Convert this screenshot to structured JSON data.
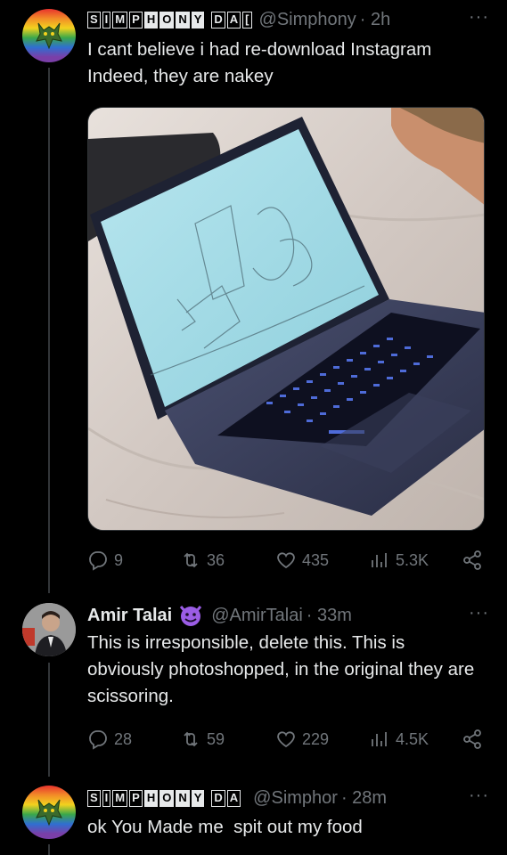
{
  "tweets": [
    {
      "display_name_chars": [
        "S",
        "I",
        "M",
        "P",
        "H",
        "O",
        "N",
        "Y",
        " ",
        "D",
        "A",
        "["
      ],
      "display_name_chars_2": [
        "S",
        "I",
        "M",
        "P",
        "H",
        "O",
        "N",
        "Y",
        " ",
        "D",
        "A"
      ],
      "handle": "@Simphony",
      "time": "· 2h",
      "more": "···",
      "text": "I cant believe i had re-download Instagram\nIndeed, they are nakey",
      "replies": "9",
      "retweets": "36",
      "likes": "435",
      "views": "5.3K"
    },
    {
      "display_name": "Amir Talai",
      "handle": "@AmirTalai",
      "time": "· 33m",
      "more": "···",
      "text": "This is irresponsible, delete this. This is obviously photoshopped, in the original they are scissoring.",
      "replies": "28",
      "retweets": "59",
      "likes": "229",
      "views": "4.5K"
    },
    {
      "handle": "@Simphor",
      "time": "· 28m",
      "more": "···",
      "text": "ok You Made me  spit out my food"
    }
  ],
  "icons": {
    "reply": "reply-icon",
    "retweet": "retweet-icon",
    "like": "heart-icon",
    "views": "views-icon",
    "share": "share-icon",
    "badge": "devil-emoji-icon"
  },
  "colors": {
    "background": "#000000",
    "text": "#e7e9ea",
    "muted": "#71767b",
    "badge": "#9b5de5"
  }
}
